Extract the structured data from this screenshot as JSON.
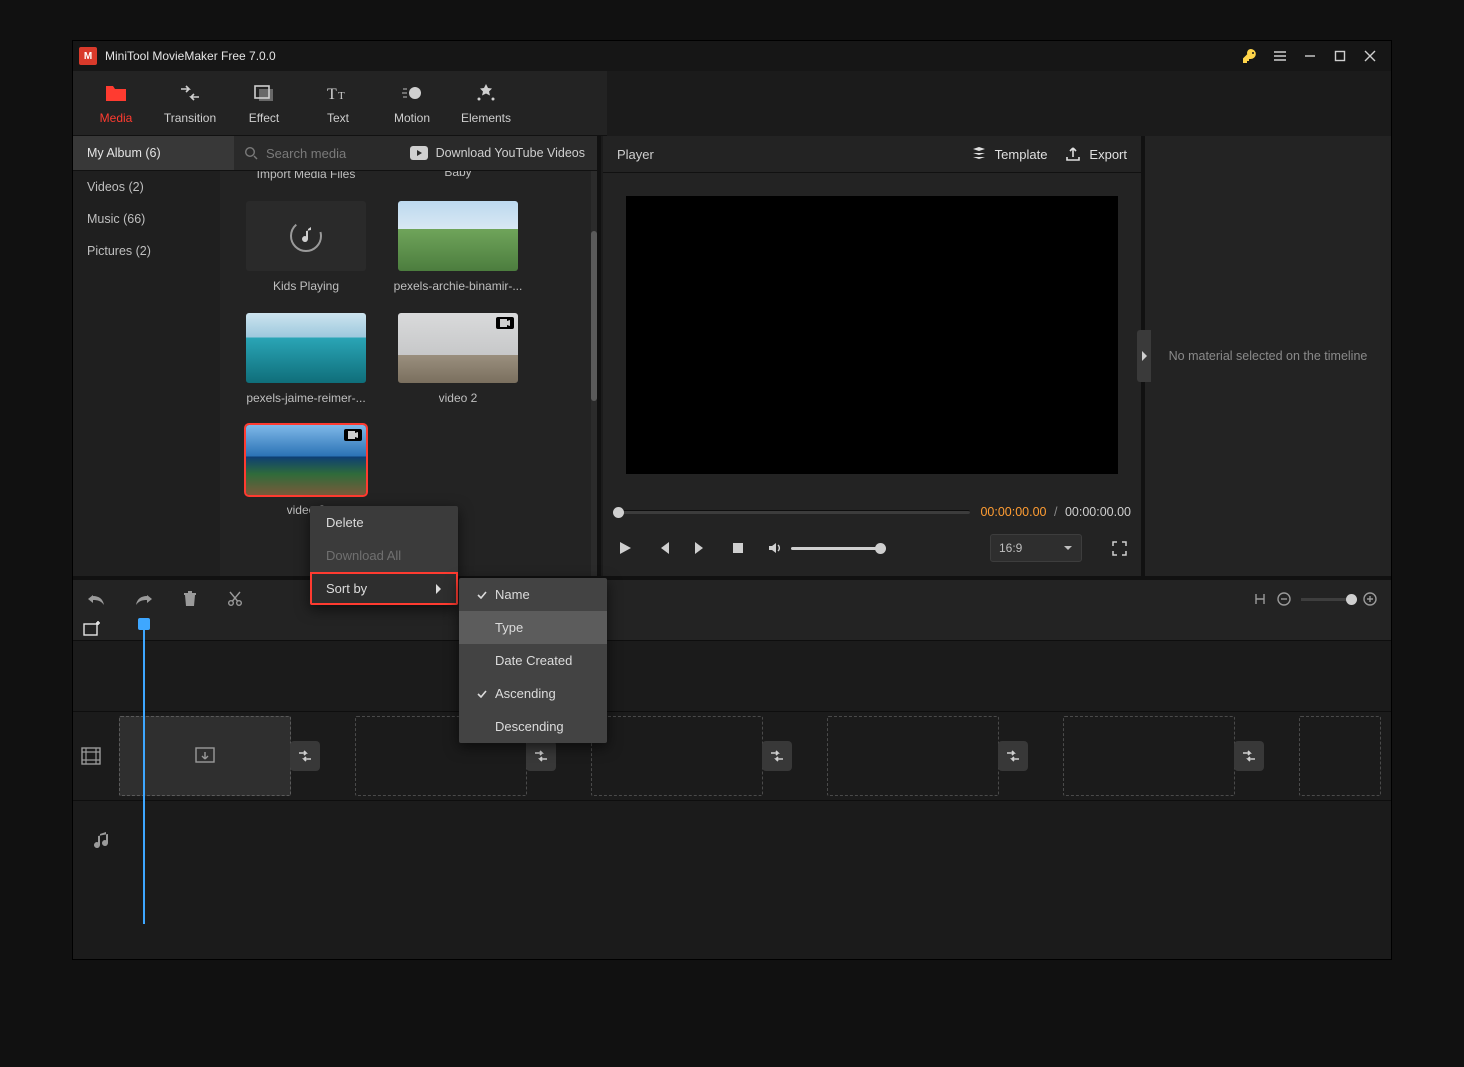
{
  "window": {
    "title": "MiniTool MovieMaker Free 7.0.0"
  },
  "toolbarTabs": {
    "media": "Media",
    "transition": "Transition",
    "effect": "Effect",
    "text": "Text",
    "motion": "Motion",
    "elements": "Elements"
  },
  "library": {
    "search_placeholder": "Search media",
    "download_yt": "Download YouTube Videos",
    "side": {
      "myalbum": "My Album (6)",
      "videos": "Videos (2)",
      "music": "Music (66)",
      "pictures": "Pictures (2)"
    },
    "cards": {
      "import": "Import Media Files",
      "baby": "Baby",
      "kids": "Kids Playing",
      "pexels1": "pexels-archie-binamir-...",
      "pexels2": "pexels-jaime-reimer-...",
      "video2": "video 2",
      "video3": "video 3"
    }
  },
  "contextMenu": {
    "delete": "Delete",
    "download_all": "Download All",
    "sort_by": "Sort by"
  },
  "sortMenu": {
    "name": "Name",
    "type": "Type",
    "date": "Date Created",
    "asc": "Ascending",
    "desc": "Descending"
  },
  "player": {
    "title": "Player",
    "template": "Template",
    "export": "Export",
    "time_current": "00:00:00.00",
    "time_total": "00:00:00.00",
    "time_sep": "/",
    "ratio": "16:9"
  },
  "inspector": {
    "empty": "No material selected on the timeline"
  }
}
